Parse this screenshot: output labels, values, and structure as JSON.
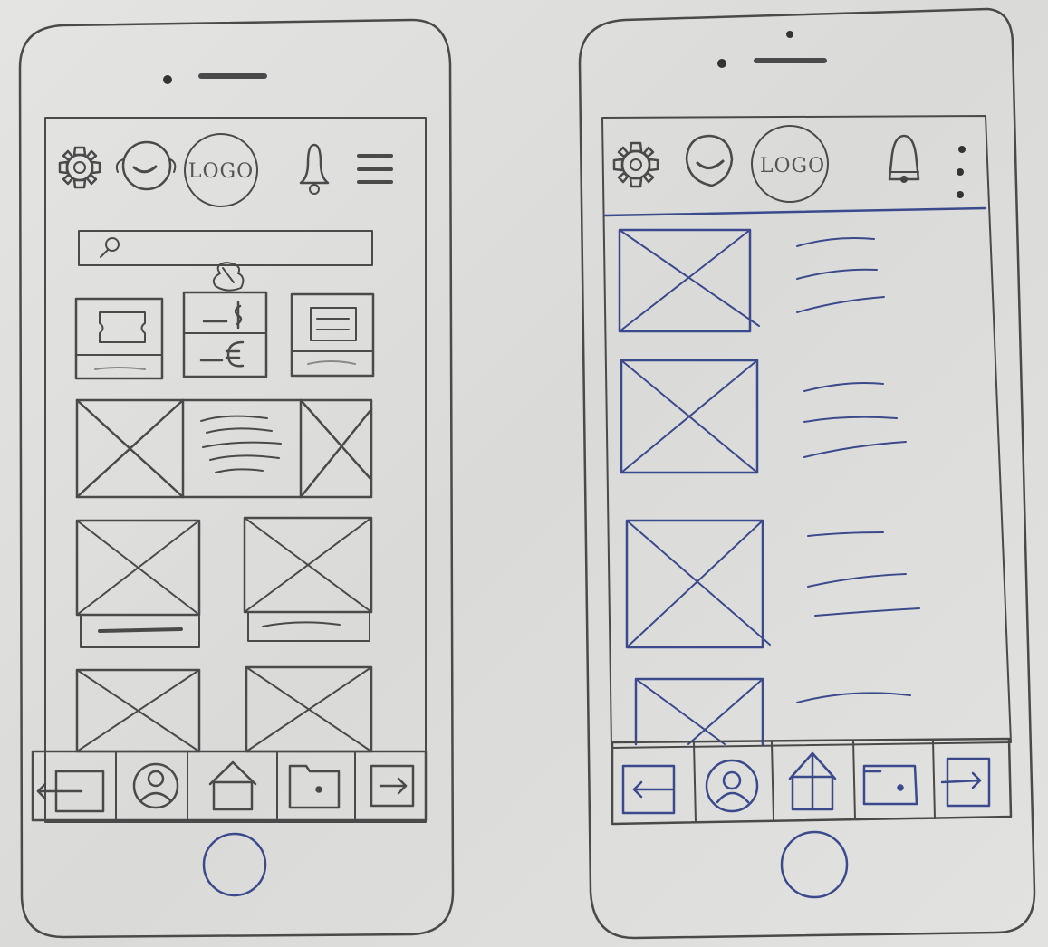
{
  "sketch_left": {
    "header": {
      "logo_text": "LOGO"
    },
    "search": {
      "placeholder": ""
    },
    "quick_actions": [
      {
        "icon": "ticket-icon"
      },
      {
        "icon": "currency-icon"
      },
      {
        "icon": "list-icon"
      }
    ],
    "bottom_nav": [
      {
        "icon": "back-icon"
      },
      {
        "icon": "profile-icon"
      },
      {
        "icon": "home-icon"
      },
      {
        "icon": "folder-icon"
      },
      {
        "icon": "logout-icon"
      }
    ]
  },
  "sketch_right": {
    "header": {
      "logo_text": "LOGO"
    },
    "list_items": 4,
    "bottom_nav": [
      {
        "icon": "back-icon"
      },
      {
        "icon": "profile-icon"
      },
      {
        "icon": "home-icon"
      },
      {
        "icon": "folder-icon"
      },
      {
        "icon": "logout-icon"
      }
    ]
  },
  "colors": {
    "paper": "#dcdcda",
    "pencil": "#4a4a4a",
    "pen": "#3b4a8c"
  }
}
